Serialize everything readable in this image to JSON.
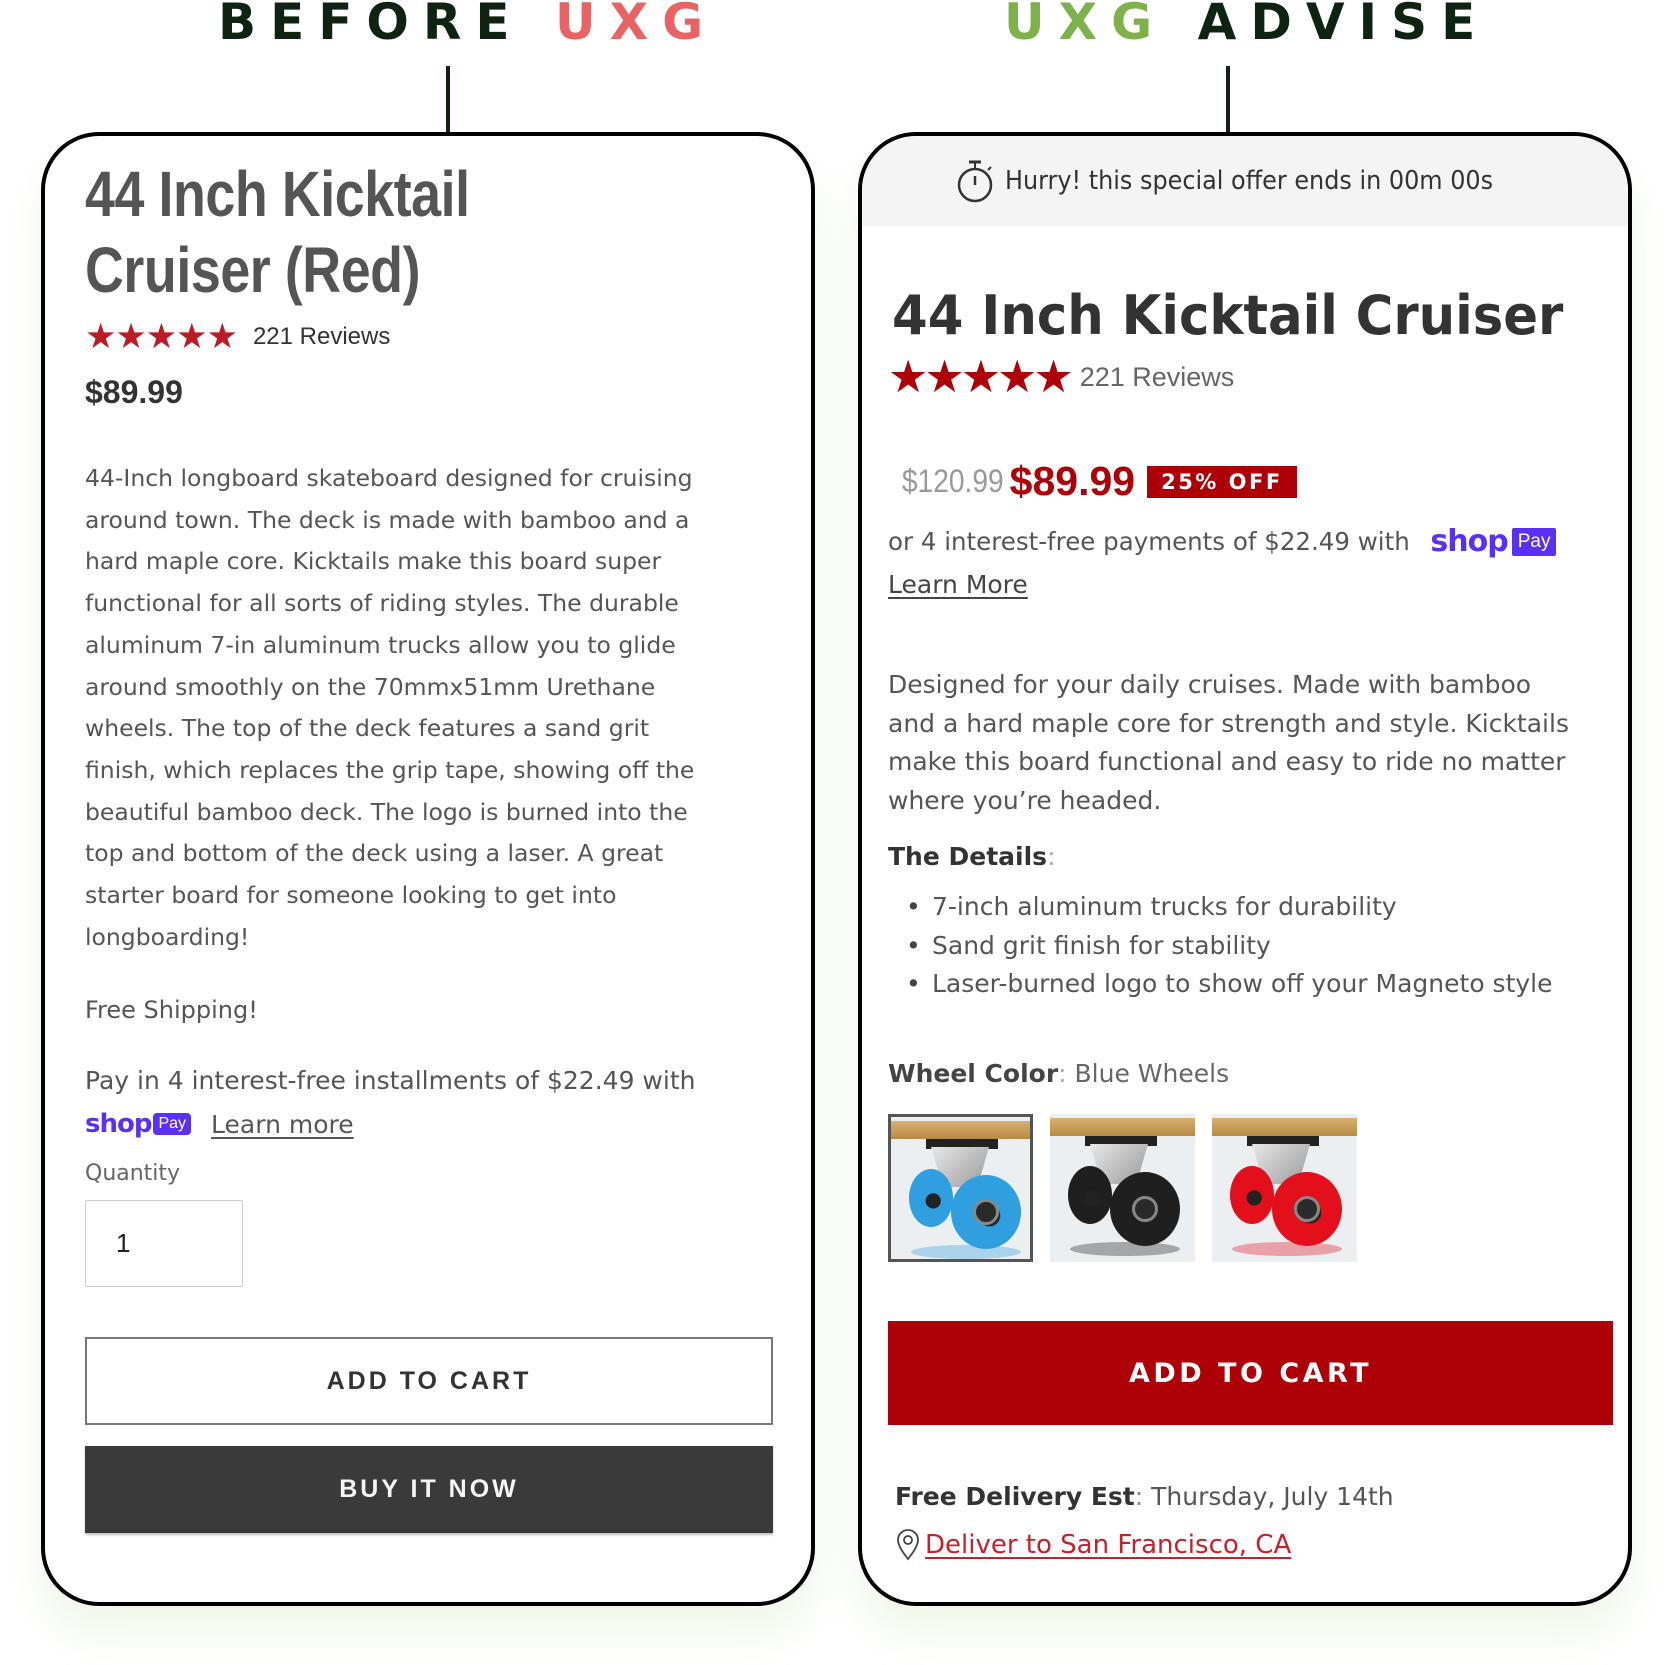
{
  "headings": {
    "before": {
      "word1": "BEFORE",
      "word2": "UXG"
    },
    "after": {
      "word1": "UXG",
      "word2": "ADVISE"
    }
  },
  "colors": {
    "heading_dark": "#0f2313",
    "heading_red": "#e86464",
    "heading_green": "#7db24a",
    "star_before": "#bb1b22",
    "accent_red": "#ad0007",
    "shop_pay_purple": "#5a31f4",
    "buy_now_bg": "#3a3a3a"
  },
  "before": {
    "title": "44 Inch Kicktail Cruiser (Red)",
    "rating": {
      "stars": 5,
      "max": 5,
      "reviews_label": "221 Reviews"
    },
    "price": "$89.99",
    "description_lines": [
      "44-Inch longboard skateboard designed for cruising",
      "around town. The deck is made with bamboo and a",
      "hard maple core. Kicktails make this board super",
      "functional for all sorts of riding styles. The durable",
      "aluminum 7-in aluminum trucks allow you to glide",
      "around smoothly on the 70mmx51mm Urethane",
      "wheels. The top of the deck features a sand grit",
      "finish, which replaces the grip tape, showing off the",
      "beautiful bamboo deck. The logo is burned into the",
      "top and bottom of the deck using a laser. A great",
      "starter board for someone looking to get into",
      "longboarding!"
    ],
    "free_shipping": "Free Shipping!",
    "installments_text": "Pay in 4 interest-free installments of $22.49 with",
    "shop_pay": {
      "shop": "shop",
      "pay": "Pay"
    },
    "learn_more": "Learn more",
    "quantity_label": "Quantity",
    "quantity_value": "1",
    "add_to_cart": "ADD TO CART",
    "buy_it_now": "BUY IT NOW"
  },
  "after": {
    "banner": {
      "icon": "stopwatch-icon",
      "text": "Hurry! this special offer ends in  00m 00s"
    },
    "title": "44 Inch Kicktail Cruiser",
    "rating": {
      "stars": 5,
      "max": 5,
      "reviews_label": "221 Reviews"
    },
    "original_price": "$120.99",
    "sale_price": "$89.99",
    "discount_badge": "25% OFF",
    "payments_text": "or 4 interest-free payments of $22.49 with",
    "shop_pay": {
      "shop": "shop",
      "pay": "Pay"
    },
    "learn_more": "Learn More",
    "description_lines": [
      "Designed for your daily cruises. Made with bamboo",
      "and a hard maple core for strength and style. Kicktails",
      "make this board functional and easy to ride no matter",
      "where you’re headed."
    ],
    "details_label": "The Details",
    "details_colon": ":",
    "details": [
      "7-inch aluminum trucks for durability",
      "Sand grit finish for stability",
      "Laser-burned logo to show off your Magneto style"
    ],
    "wheel_color_label": "Wheel Color",
    "wheel_color_value": "Blue Wheels",
    "wheel_options": [
      {
        "name": "Blue Wheels",
        "color": "#2f9fe0",
        "selected": true
      },
      {
        "name": "Black Wheels",
        "color": "#1f1f1f",
        "selected": false
      },
      {
        "name": "Red Wheels",
        "color": "#e3101c",
        "selected": false
      }
    ],
    "add_to_cart": "ADD TO CART",
    "delivery_label": "Free Delivery Est",
    "delivery_date": "Thursday, July 14th",
    "deliver_to": "Deliver to San Francisco, CA"
  }
}
